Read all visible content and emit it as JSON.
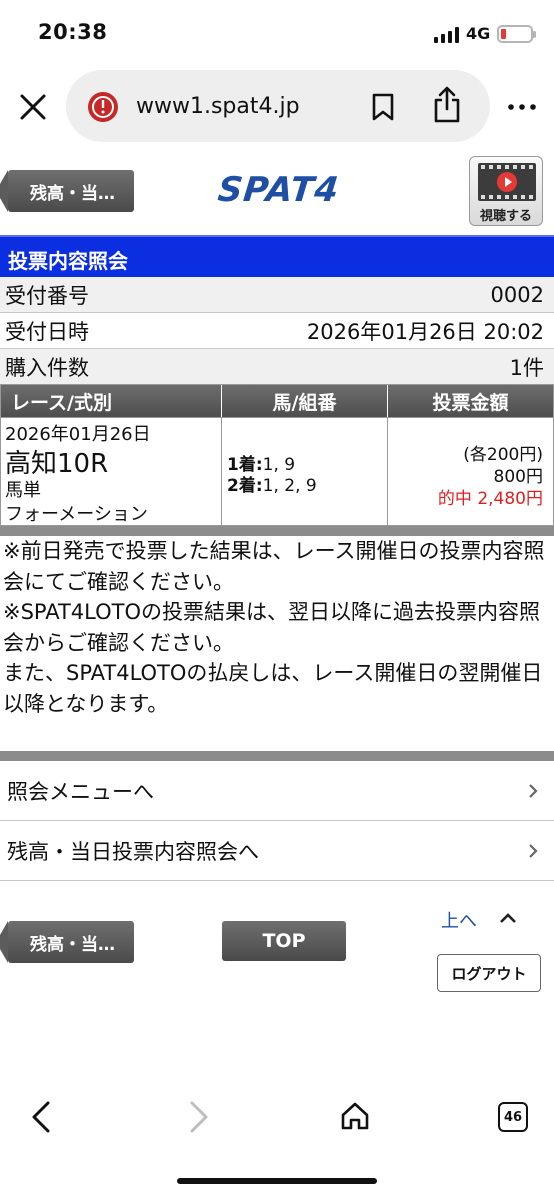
{
  "status": {
    "time": "20:38",
    "network": "4G"
  },
  "browser": {
    "url": "www1.spat4.jp",
    "tab_count": "46"
  },
  "header": {
    "back_label": "残高・当…",
    "logo_text": "SPAT4",
    "video_label": "視聴する"
  },
  "section": {
    "title": "投票内容照会"
  },
  "info": [
    {
      "label": "受付番号",
      "value": "0002"
    },
    {
      "label": "受付日時",
      "value": "2026年01月26日 20:02"
    },
    {
      "label": "購入件数",
      "value": "1件"
    }
  ],
  "table": {
    "headers": [
      "レース/式別",
      "馬/組番",
      "投票金額"
    ],
    "row": {
      "date": "2026年01月26日",
      "race": "高知10R",
      "bet_type": "馬単",
      "method": "フォーメーション",
      "combo1_label": "1着:",
      "combo1_value": "1, 9",
      "combo2_label": "2着:",
      "combo2_value": "1, 2, 9",
      "amount_each": "(各200円)",
      "amount_total": "800円",
      "hit": "的中 2,480円"
    }
  },
  "notes": [
    "※前日発売で投票した結果は、レース開催日の投票内容照会にてご確認ください。",
    "※SPAT4LOTOの投票結果は、翌日以降に過去投票内容照会からご確認ください。",
    "また、SPAT4LOTOの払戻しは、レース開催日の翌開催日以降となります。"
  ],
  "links": [
    {
      "label": "照会メニューへ"
    },
    {
      "label": "残高・当日投票内容照会へ"
    }
  ],
  "footer": {
    "back_label": "残高・当…",
    "top_label": "TOP",
    "up_label": "上へ",
    "logout_label": "ログアウト"
  },
  "colors": {
    "accent_blue": "#0b2ee0",
    "hit_red": "#e02020",
    "logo_blue": "#1f4fa5"
  }
}
